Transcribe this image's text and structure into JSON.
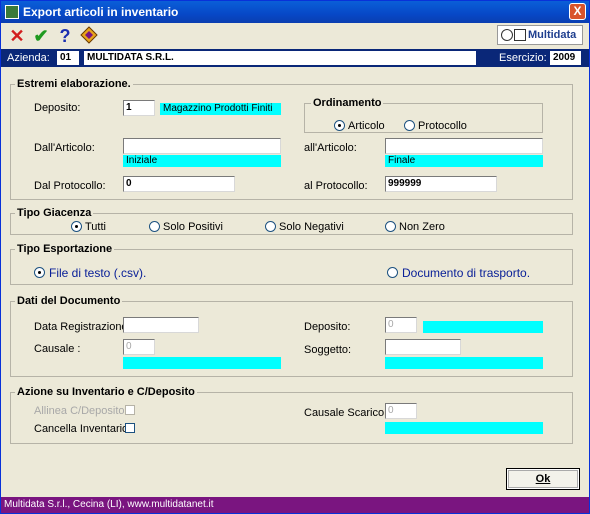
{
  "window": {
    "title": "Export articoli in inventario",
    "close_label": "X"
  },
  "toolbar": {
    "logo_text": "Multidata"
  },
  "company": {
    "azienda_label": "Azienda:",
    "azienda_code": "01",
    "azienda_name": "MULTIDATA S.R.L.",
    "esercizio_label": "Esercizio:",
    "esercizio_value": "2009"
  },
  "estremi": {
    "title": "Estremi elaborazione.",
    "deposito_label": "Deposito:",
    "deposito_value": "1",
    "deposito_desc": "Magazzino Prodotti Finiti",
    "ordinamento": {
      "title": "Ordinamento",
      "options": [
        "Articolo",
        "Protocollo"
      ],
      "selected": "Articolo"
    },
    "dall_articolo_label": "Dall'Articolo:",
    "dall_articolo_value": "",
    "dall_articolo_desc": "Iniziale",
    "all_articolo_label": "all'Articolo:",
    "all_articolo_value": "",
    "all_articolo_desc": "Finale",
    "dal_protocollo_label": "Dal Protocollo:",
    "dal_protocollo_value": "0",
    "al_protocollo_label": "al Protocollo:",
    "al_protocollo_value": "999999"
  },
  "giacenza": {
    "title": "Tipo Giacenza",
    "options": [
      "Tutti",
      "Solo Positivi",
      "Solo Negativi",
      "Non Zero"
    ],
    "selected": "Tutti"
  },
  "esportazione": {
    "title": "Tipo Esportazione",
    "options": [
      "File di testo (.csv).",
      "Documento di trasporto."
    ],
    "selected": "File di testo (.csv)."
  },
  "documento": {
    "title": "Dati del Documento",
    "data_reg_label": "Data Registrazione:",
    "data_reg_value": "",
    "causale_label": "Causale :",
    "causale_value": "0",
    "deposito_label": "Deposito:",
    "deposito_value": "0",
    "soggetto_label": "Soggetto:",
    "soggetto_value": ""
  },
  "azione": {
    "title": "Azione su Inventario e C/Deposito",
    "allinea_label": "Allinea C/Deposito:",
    "cancella_label": "Cancella Inventario:",
    "causale_scarico_label": "Causale Scarico:",
    "causale_scarico_value": "0"
  },
  "ok_label": "Ok",
  "statusbar": "Multidata S.r.l., Cecina (LI), www.multidatanet.it",
  "colors": {
    "title_blue": "#0748c7",
    "company_bar": "#0a2778",
    "status_bar": "#7a1580",
    "cyan": "#00ffff"
  }
}
